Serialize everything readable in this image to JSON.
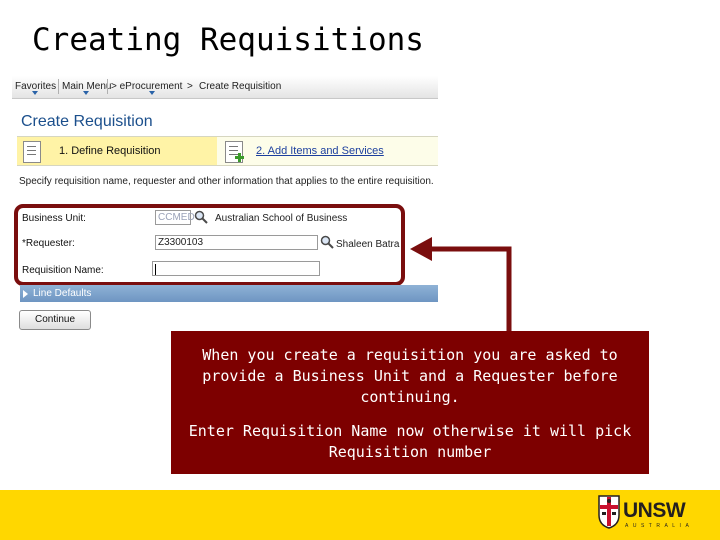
{
  "slide": {
    "title": "Creating Requisitions"
  },
  "navbar": {
    "items": [
      "Favorites",
      "Main Menu",
      "> eProcurement",
      ">",
      "Create Requisition"
    ]
  },
  "page": {
    "heading": "Create Requisition",
    "steps": [
      {
        "label": "1. Define Requisition"
      },
      {
        "label": "2. Add Items and Services"
      }
    ],
    "intro": "Specify requisition name, requester and other information that applies to the entire requisition."
  },
  "form": {
    "business_unit": {
      "label": "Business Unit:",
      "value": "CCMED",
      "description": "Australian School of Business"
    },
    "requester": {
      "label": "*Requester:",
      "value": "Z3300103",
      "description": "Shaleen Batra"
    },
    "requisition_name": {
      "label": "Requisition Name:",
      "value": ""
    }
  },
  "line_defaults": {
    "label": "Line Defaults"
  },
  "continue_button": {
    "label": "Continue"
  },
  "note": {
    "paragraph1": "When you create a requisition you are asked to provide a Business Unit and a Requester before continuing.",
    "paragraph2": "Enter Requisition Name now otherwise it will pick Requisition number"
  },
  "footer": {
    "logo_text": "UNSW",
    "logo_subtext": "AUSTRALIA"
  },
  "colors": {
    "note_background": "#7d0000",
    "callout_border": "#7a0e0e",
    "footer_background": "#ffd700",
    "link_blue": "#1c3f9e"
  },
  "icons": {
    "lookup": "magnifier-icon",
    "step1": "document-edit-icon",
    "step2": "document-add-icon",
    "crest": "unsw-crest-icon"
  }
}
